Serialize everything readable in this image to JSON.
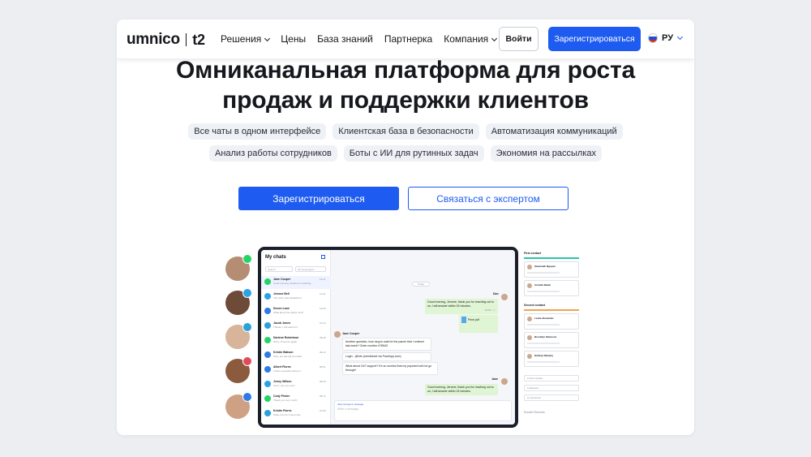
{
  "nav": {
    "logo": "umnico",
    "logo_partner": "t2",
    "menu": [
      {
        "label": "Решения",
        "dropdown": true
      },
      {
        "label": "Цены",
        "dropdown": false
      },
      {
        "label": "База знаний",
        "dropdown": false
      },
      {
        "label": "Партнерка",
        "dropdown": false
      },
      {
        "label": "Компания",
        "dropdown": true
      }
    ],
    "login_label": "Войти",
    "register_label": "Зарегистрироваться",
    "language": "РУ"
  },
  "hero": {
    "title_line1": "Омниканальная платформа для роста",
    "title_line2": "продаж и поддержки клиентов",
    "tags_row1": [
      "Все чаты в одном интерфейсе",
      "Клиентская база в безопасности",
      "Автоматизация коммуникаций"
    ],
    "tags_row2": [
      "Анализ работы сотрудников",
      "Боты с ИИ для рутинных задач",
      "Экономия на рассылках"
    ],
    "cta_primary": "Зарегистрироваться",
    "cta_secondary": "Связаться с экспертом"
  },
  "colors": {
    "accent": "#1e5bf0",
    "background": "#eceef1",
    "text": "#16181d",
    "tag_bg": "#eef1f6"
  },
  "channel_avatars": [
    {
      "badge_icon": "whatsapp-icon",
      "badge_color": "#25d366"
    },
    {
      "badge_icon": "messenger-icon",
      "badge_color": "#2aa3e6"
    },
    {
      "badge_icon": "telegram-icon",
      "badge_color": "#2aa1da"
    },
    {
      "badge_icon": "instagram-icon",
      "badge_color": "#e24a5c"
    },
    {
      "badge_icon": "vk-icon",
      "badge_color": "#2f7be5"
    }
  ],
  "app_preview": {
    "title": "My chats",
    "search_placeholder": "Search",
    "filter_label": "All messengers",
    "chats": [
      {
        "name": "Jane Cooper",
        "preview": "Good morning, thanks for reaching...",
        "time": "13:11",
        "color": "#25d366"
      },
      {
        "name": "Jerome Bell",
        "preview": "The order was dispatched",
        "time": "12:41",
        "color": "#2aa3e6"
      },
      {
        "name": "Devon Lane",
        "preview": "What about the status now?",
        "time": "10:25",
        "color": "#2f7be5"
      },
      {
        "name": "Jacob Jones",
        "preview": "Thanks, I will wait for it",
        "time": "10:12",
        "color": "#2aa1da"
      },
      {
        "name": "Darlene Robertson",
        "preview": "Sorry, I'll send it again",
        "time": "09:40",
        "color": "#25d366"
      },
      {
        "name": "Kristin Watson",
        "preview": "Sure, we will call you back",
        "time": "09:12",
        "color": "#2f7be5"
      },
      {
        "name": "Albert Flores",
        "preview": "I have a question about it",
        "time": "08:51",
        "color": "#2f7be5"
      },
      {
        "name": "Jenny Wilson",
        "preview": "Got it, see you soon",
        "time": "08:30",
        "color": "#2aa3e6"
      },
      {
        "name": "Cody Fisher",
        "preview": "Thank you very much!",
        "time": "08:12",
        "color": "#25d366"
      },
      {
        "name": "Kristin Flores",
        "preview": "Okay, let's do it tomorrow",
        "time": "07:56",
        "color": "#2aa1da"
      }
    ],
    "day_label": "Today",
    "agent_name": "Dan",
    "msg_out_1": "Good morning, Jerome, thank you for reaching out to us, I will answer within 15 minutes.",
    "file_name": "Price.pdf",
    "client_name": "Jane Cooper",
    "msg_in_1": "Another question, how long to wait for the parcel that I ordered last week? Order number #76543",
    "msg_in_2": "Login - @info (mentioned via FaceApp.com)",
    "msg_in_3": "What about 24/7 support? It's so worried that my payment will not go through!",
    "agent_name_2": "Jane",
    "msg_out_2": "Good evening, Jerome, thank you for reaching out to us, I will answer within 15 minutes.",
    "reply_label": "Jane Cooper's message",
    "input_placeholder": "Write a message..."
  },
  "crm_preview": {
    "stage1": "First contact",
    "stage2": "Second contact",
    "contacts": [
      "Savannah Nguyen",
      "Annette Black",
      "Leslie Alexander",
      "Brooklyn Simmons",
      "Kathryn Murphy"
    ],
    "events": [
      "First contact",
      "Refused",
      "Converted"
    ],
    "footer": "Ronald Richards"
  }
}
